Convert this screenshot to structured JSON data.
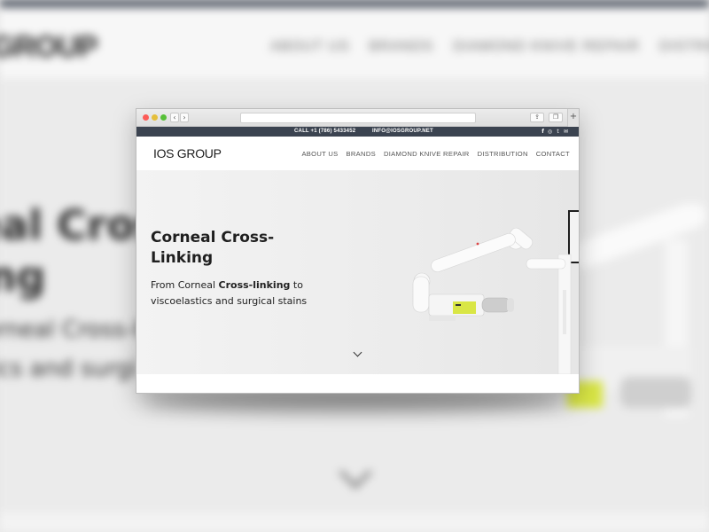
{
  "background": {
    "logo": "GROUP",
    "nav": [
      "ABOUT US",
      "BRANDS",
      "DIAMOND KNIVE REPAIR",
      "DISTRIBUTION"
    ],
    "title_lines": [
      "eal Cros",
      "ing"
    ],
    "sub_lines": [
      "orneal Cross-li",
      "tics and surgi"
    ]
  },
  "browser": {
    "url": "",
    "back_icon": "‹",
    "forward_icon": "›",
    "share_icon": "⇪",
    "tabs_icon": "❐",
    "new_tab_icon": "+"
  },
  "topbar": {
    "phone": "CALL +1 (786) 5433452",
    "email": "INFO@IOSGROUP.NET",
    "social": {
      "facebook": "f",
      "instagram": "◎",
      "twitter": "t",
      "mail": "✉"
    }
  },
  "site": {
    "logo": "IOS GROUP",
    "nav": {
      "about": "ABOUT US",
      "brands": "BRANDS",
      "repair": "DIAMOND KNIVE REPAIR",
      "distribution": "DISTRIBUTION",
      "contact": "CONTACT"
    }
  },
  "hero": {
    "title": "Corneal Cross-Linking",
    "sub_prefix": "From Corneal ",
    "sub_bold": "Cross-linking",
    "sub_suffix": " to viscoelastics and surgical stains"
  },
  "colors": {
    "topbar": "#3b4350",
    "accent_yellow": "#d9e645",
    "traffic_red": "#fc5b57",
    "traffic_yellow": "#e5bf3c",
    "traffic_green": "#57c038"
  }
}
